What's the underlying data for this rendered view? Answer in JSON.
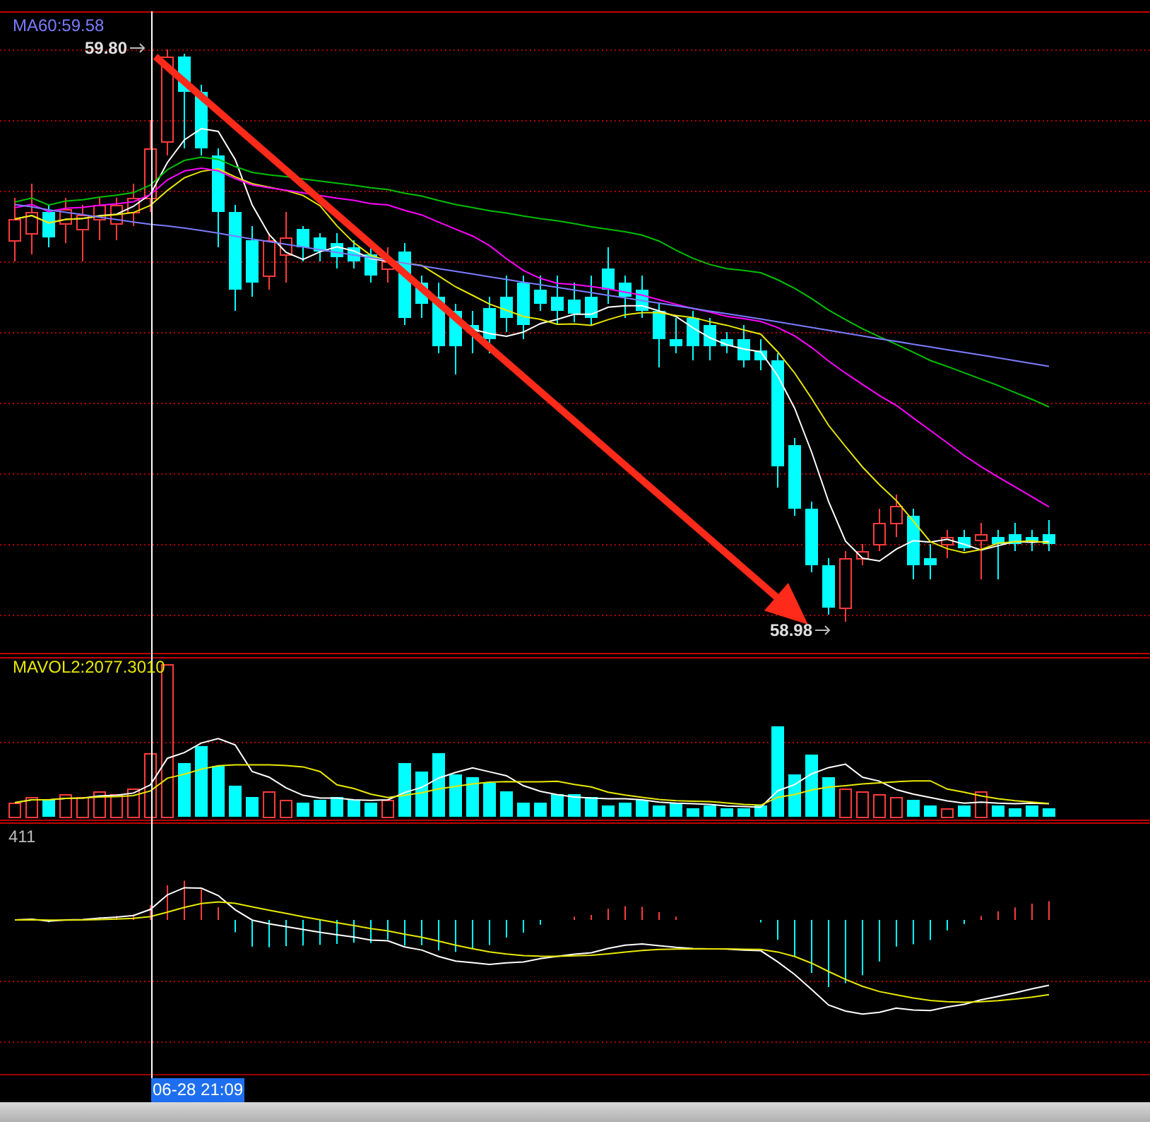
{
  "main_panel": {
    "legend": [
      {
        "text": "MA60:59.58",
        "color": "#7b7bff"
      }
    ],
    "high_label": "59.80",
    "low_label": "58.98"
  },
  "volume_panel": {
    "legend": [
      {
        "text": "MAVOL2:2077.3010",
        "color": "#e8e800"
      }
    ]
  },
  "macd_panel": {
    "legend": [
      {
        "text": "411",
        "color": "#bbbbbb"
      }
    ]
  },
  "time_axis": {
    "crosshair_time": "06-28 21:09"
  }
}
